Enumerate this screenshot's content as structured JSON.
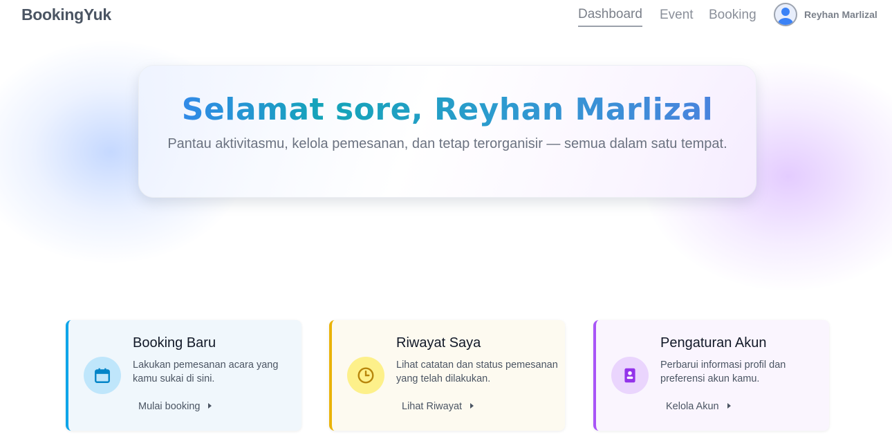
{
  "brand": "BookingYuk",
  "nav": {
    "links": [
      {
        "label": "Dashboard",
        "active": true
      },
      {
        "label": "Event",
        "active": false
      },
      {
        "label": "Booking",
        "active": false
      }
    ],
    "user_name": "Reyhan Marlizal",
    "avatar_icon": "user-avatar-icon"
  },
  "hero": {
    "title": "Selamat sore, Reyhan Marlizal",
    "subtitle": "Pantau aktivitasmu, kelola pemesanan, dan tetap terorganisir — semua dalam satu tempat."
  },
  "cards": [
    {
      "title": "Booking Baru",
      "description": "Lakukan pemesanan acara yang kamu sukai di sini.",
      "link": "Mulai booking",
      "icon": "calendar-icon",
      "accent": "#0ea5e9",
      "background": "#f0f7fc",
      "icon_bg": "#bfe6fb",
      "icon_color": "#0284c7"
    },
    {
      "title": "Riwayat Saya",
      "description": "Lihat catatan dan status pemesanan yang telah dilakukan.",
      "link": "Lihat Riwayat",
      "icon": "clock-icon",
      "accent": "#eab308",
      "background": "#fdfaf0",
      "icon_bg": "#fdf08a",
      "icon_color": "#b7850b"
    },
    {
      "title": "Pengaturan Akun",
      "description": "Perbarui informasi profil dan preferensi akun kamu.",
      "link": "Kelola Akun",
      "icon": "contact-card-icon",
      "accent": "#a855f7",
      "background": "#faf5fe",
      "icon_bg": "#ead5fd",
      "icon_color": "#9333ea"
    }
  ]
}
